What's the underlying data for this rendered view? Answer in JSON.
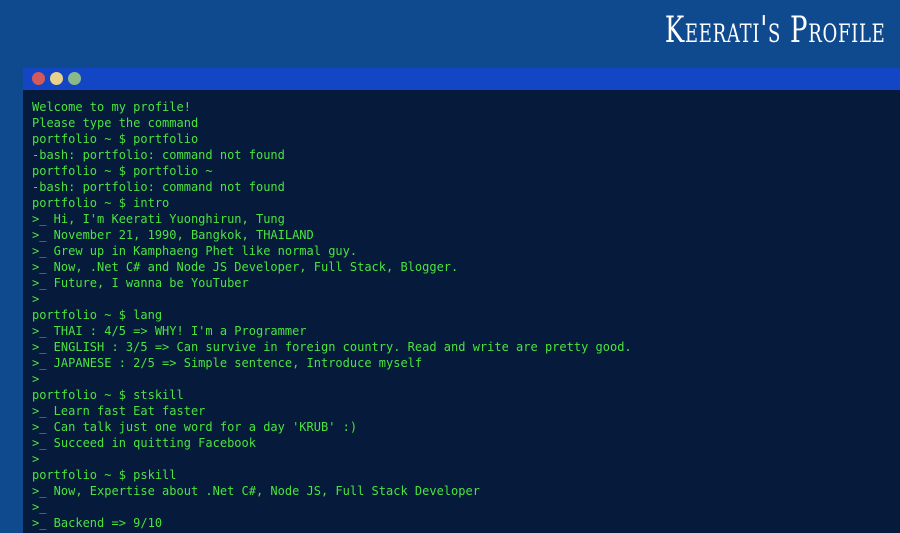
{
  "header": {
    "title": "Keerati's Profile"
  },
  "window": {
    "controls": [
      {
        "name": "close",
        "color": "#d35a5a"
      },
      {
        "name": "minimize",
        "color": "#e9d28c"
      },
      {
        "name": "maximize",
        "color": "#8bb98a"
      }
    ]
  },
  "terminal": {
    "text_color": "#4be33f",
    "background": "#061a3b",
    "lines": [
      "Welcome to my profile!",
      "Please type the command",
      "portfolio ~ $ portfolio",
      "-bash: portfolio: command not found",
      "portfolio ~ $ portfolio ~",
      "-bash: portfolio: command not found",
      "portfolio ~ $ intro",
      ">_ Hi, I'm Keerati Yuonghirun, Tung",
      ">_ November 21, 1990, Bangkok, THAILAND",
      ">_ Grew up in Kamphaeng Phet like normal guy.",
      ">_ Now, .Net C# and Node JS Developer, Full Stack, Blogger.",
      ">_ Future, I wanna be YouTuber",
      ">",
      "portfolio ~ $ lang",
      ">_ THAI : 4/5 => WHY! I'm a Programmer",
      ">_ ENGLISH : 3/5 => Can survive in foreign country. Read and write are pretty good.",
      ">_ JAPANESE : 2/5 => Simple sentence, Introduce myself",
      ">",
      "portfolio ~ $ stskill",
      ">_ Learn fast Eat faster",
      ">_ Can talk just one word for a day 'KRUB' :)",
      ">_ Succeed in quitting Facebook",
      ">",
      "portfolio ~ $ pskill",
      ">_ Now, Expertise about .Net C#, Node JS, Full Stack Developer",
      ">_",
      ">_ Backend => 9/10"
    ]
  }
}
